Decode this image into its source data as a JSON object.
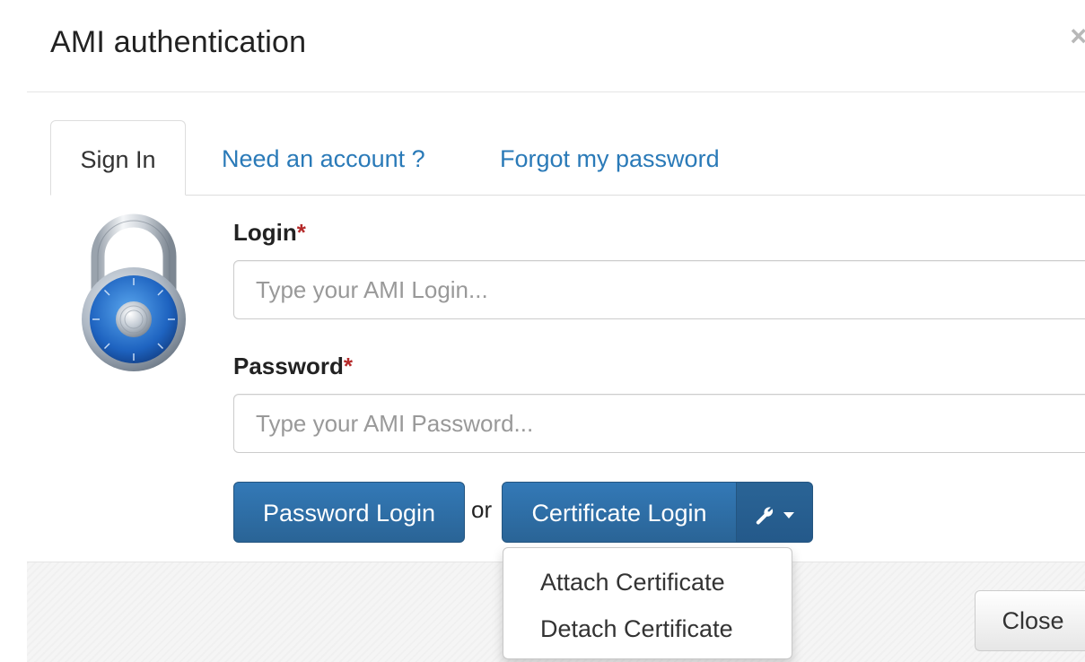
{
  "modal": {
    "title": "AMI authentication",
    "close_icon": "×"
  },
  "tabs": [
    {
      "label": "Sign In",
      "active": true
    },
    {
      "label": "Need an account ?",
      "active": false
    },
    {
      "label": "Forgot my password",
      "active": false
    }
  ],
  "form": {
    "login_label": "Login",
    "password_label": "Password",
    "required_mark": "*",
    "login_placeholder": "Type your AMI Login...",
    "password_placeholder": "Type your AMI Password...",
    "login_value": "",
    "password_value": ""
  },
  "buttons": {
    "password_login": "Password Login",
    "or": "or",
    "certificate_login": "Certificate Login",
    "close": "Close"
  },
  "dropdown": {
    "items": [
      "Attach Certificate",
      "Detach Certificate"
    ]
  },
  "icons": {
    "lock": "padlock-icon",
    "wrench": "wrench-icon",
    "caret": "caret-down-icon",
    "close": "close-icon"
  },
  "colors": {
    "primary": "#2d6ca2",
    "link": "#2a7ab8",
    "required": "#b52a2a"
  }
}
